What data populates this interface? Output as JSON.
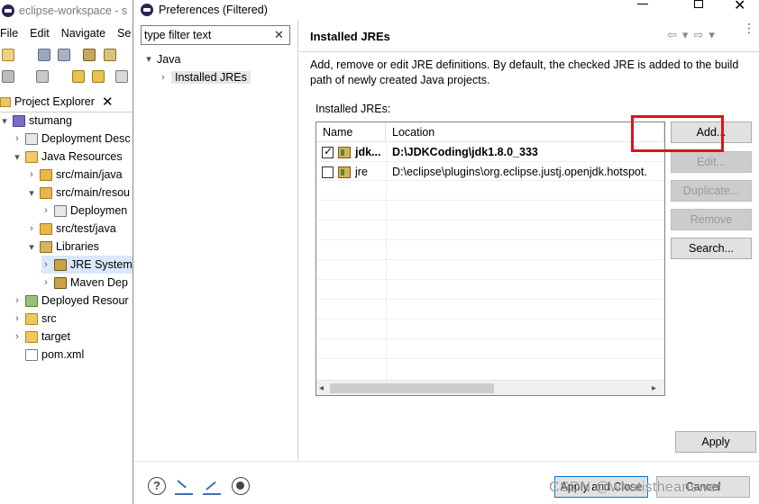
{
  "workbench": {
    "window_title": "eclipse-workspace - s",
    "menu": [
      "File",
      "Edit",
      "Navigate",
      "Se"
    ],
    "project_explorer": {
      "tab_label": "Project Explorer",
      "close": "✕",
      "nodes": [
        {
          "label": "stumang",
          "twisty": "▾"
        },
        {
          "label": "Deployment Desc",
          "twisty": "›"
        },
        {
          "label": "Java Resources",
          "twisty": "▾"
        },
        {
          "label": "src/main/java",
          "twisty": "›"
        },
        {
          "label": "src/main/resou",
          "twisty": "▾"
        },
        {
          "label": "Deploymen",
          "twisty": "›"
        },
        {
          "label": "src/test/java",
          "twisty": "›"
        },
        {
          "label": "Libraries",
          "twisty": "▾"
        },
        {
          "label": "JRE System",
          "twisty": "›"
        },
        {
          "label": "Maven Dep",
          "twisty": "›"
        },
        {
          "label": "Deployed Resour",
          "twisty": "›"
        },
        {
          "label": "src",
          "twisty": "›"
        },
        {
          "label": "target",
          "twisty": "›"
        },
        {
          "label": "pom.xml",
          "twisty": ""
        }
      ]
    }
  },
  "dialog": {
    "title": "Preferences (Filtered)",
    "window_controls": {
      "minimize": "—",
      "maximize": "☐",
      "close": "✕"
    },
    "filter": {
      "value": "type filter text",
      "clear": "✕"
    },
    "tree": [
      {
        "label": "Java",
        "twisty": "▾"
      },
      {
        "label": "Installed JREs",
        "twisty": "›"
      }
    ],
    "page": {
      "title": "Installed JREs",
      "nav": {
        "back": "⇦",
        "back_menu": "▾",
        "forward": "⇨",
        "forward_menu": "▾",
        "menu": "⋮"
      },
      "description": "Add, remove or edit JRE definitions. By default, the checked JRE is added to the build path of newly created Java projects.",
      "jres_label": "Installed JREs:",
      "columns": [
        "Name",
        "Location"
      ],
      "rows": [
        {
          "checked": true,
          "name": "jdk...",
          "location": "D:\\JDKCoding\\jdk1.8.0_333",
          "bold": true
        },
        {
          "checked": false,
          "name": "jre",
          "location": "D:\\eclipse\\plugins\\org.eclipse.justj.openjdk.hotspot.",
          "bold": false
        }
      ],
      "scroll": {
        "left": "◂",
        "right": "▸"
      },
      "buttons": {
        "add": "Add...",
        "edit": "Edit...",
        "duplicate": "Duplicate...",
        "remove": "Remove",
        "search": "Search...",
        "apply": "Apply"
      }
    },
    "footer": {
      "help_icon_glyph": "?",
      "apply_and_close": "Apply and Close",
      "cancel": "Cancel"
    }
  },
  "watermark": "CSDN @whatistheanswer",
  "colors": {
    "highlight": "#e0121a",
    "focus_border": "#0078d7"
  }
}
